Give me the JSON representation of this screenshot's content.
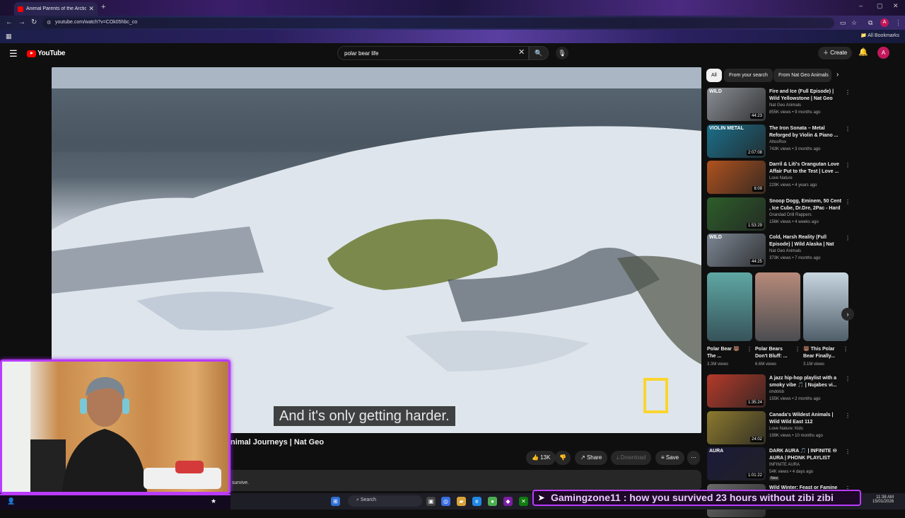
{
  "browser": {
    "tab_title": "Animal Parents of the Arctic",
    "new_tab": "+",
    "url": "youtube.com/watch?v=COk05hbc_co",
    "all_bookmarks": "All Bookmarks",
    "profile_initial": "A"
  },
  "youtube": {
    "logo_text": "YouTube",
    "search_query": "polar bear life",
    "create_label": "Create",
    "avatar_initial": "A"
  },
  "video": {
    "subtitle": "And it's only getting harder.",
    "title": "nimal Journeys | Nat Geo",
    "likes": "13K",
    "share_label": "Share",
    "download_label": "Download",
    "save_label": "Save",
    "description_snippet": "survive."
  },
  "sidebar": {
    "chips": [
      {
        "label": "All",
        "active": true
      },
      {
        "label": "From your search",
        "active": false
      },
      {
        "label": "From Nat Geo Animals",
        "active": false
      }
    ],
    "recommendations": [
      {
        "title": "Fire and Ice (Full Episode) | Wild Yellowstone | Nat Geo Animals",
        "channel": "Nat Geo Animals",
        "meta": "855K views • 9 months ago",
        "duration": "44:23",
        "thumb_label": "WILD",
        "color": "#8a8f96"
      },
      {
        "title": "The Iron Sonata – Metal Reforged by Violin & Piano ...",
        "channel": "AltosRox",
        "meta": "743K views • 3 months ago",
        "duration": "2:07:08",
        "thumb_label": "VIOLIN METAL",
        "color": "#1b6f8a"
      },
      {
        "title": "Darril & Liti's Orangutan Love Affair Put to the Test | Love ...",
        "channel": "Love Nature",
        "meta": "229K views • 4 years ago",
        "duration": "8:09",
        "thumb_label": "",
        "color": "#b0521e"
      },
      {
        "title": "Snoop Dogg, Eminem, 50 Cent , Ice Cube, Dr.Dre, 2Pac - Hard t...",
        "channel": "Grandad Drill Rappers",
        "meta": "156K views • 4 weeks ago",
        "duration": "1:53:29",
        "thumb_label": "",
        "color": "#2d5e2a"
      },
      {
        "title": "Cold, Harsh Reality (Full Episode) | Wild Alaska | Nat Ge...",
        "channel": "Nat Geo Animals",
        "meta": "373K views • 7 months ago",
        "duration": "44:25",
        "thumb_label": "WILD",
        "color": "#7c8794"
      }
    ],
    "shorts": [
      {
        "title": "Polar Bear 🐻 The ...",
        "views": "3.3M views",
        "color": "#5fa7a3"
      },
      {
        "title": "Polar Bears Don't Bluff: ...",
        "views": "6.6M views",
        "color": "#b78a7a"
      },
      {
        "title": "🐻 This Polar Bear Finally...",
        "views": "3.1M views",
        "color": "#c8d6e0"
      }
    ],
    "recommendations_2": [
      {
        "title": "A jazz hip-hop playlist with a smoky vibe 🎵 | Nujabes vi...",
        "channel": "ondolsb",
        "meta": "155K views • 2 months ago",
        "duration": "1:35:24",
        "thumb_label": "",
        "color": "#b53a2a",
        "badge": ""
      },
      {
        "title": "Canada's Wildest Animals | Wild Wild East 112",
        "channel": "Love Nature: Kids",
        "meta": "199K views • 10 months ago",
        "duration": "24:02",
        "thumb_label": "",
        "color": "#8c7a2e",
        "badge": ""
      },
      {
        "title": "DARK AURA 🎵 | INFINITE ♾ AURA | PHONK PLAYLIST FOR...",
        "channel": "INFINITE AURA",
        "meta": "54K views • 4 days ago",
        "duration": "1:01:22",
        "thumb_label": "AURA",
        "color": "#1a1a3a",
        "badge": "New"
      },
      {
        "title": "Wild Winter: Feast or Famine",
        "channel": "",
        "meta": "",
        "duration": "",
        "thumb_label": "",
        "color": "#6a6a6a",
        "badge": ""
      }
    ]
  },
  "taskbar": {
    "search_label": "Search",
    "time": "11:38 AM",
    "date": "15/01/2026"
  },
  "chat": {
    "message": "Gamingzone11 : how you survived 23 hours without zibi zibi"
  },
  "colors": {
    "youtube_red": "#ff0000",
    "overlay_purple": "#b93cff"
  }
}
